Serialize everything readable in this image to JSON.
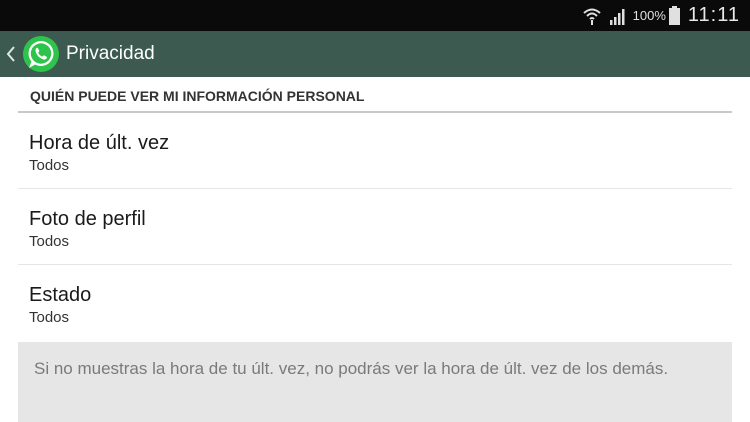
{
  "status_bar": {
    "battery_percent": "100%",
    "time": "11:11",
    "icons": [
      "wifi-icon",
      "signal-icon",
      "battery-icon"
    ]
  },
  "action_bar": {
    "title": "Privacidad",
    "back_icon": "chevron-left-icon",
    "logo_icon": "whatsapp-logo",
    "color": "#3d5a50"
  },
  "section": {
    "header": "QUIÉN PUEDE VER MI INFORMACIÓN PERSONAL",
    "items": [
      {
        "title": "Hora de últ. vez",
        "value": "Todos"
      },
      {
        "title": "Foto de perfil",
        "value": "Todos"
      },
      {
        "title": "Estado",
        "value": "Todos"
      }
    ]
  },
  "info": {
    "text": "Si no muestras la hora de tu últ. vez, no podrás ver la hora de últ. vez de los demás."
  }
}
